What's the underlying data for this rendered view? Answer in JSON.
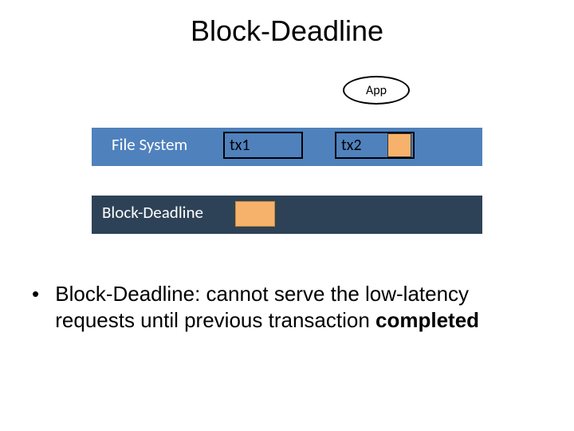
{
  "title": "Block-Deadline",
  "app_label": "App",
  "fs": {
    "label": "File System",
    "tx1": "tx1",
    "tx2": "tx2"
  },
  "bd": {
    "label": "Block-Deadline"
  },
  "bullet": {
    "dot": "•",
    "text_prefix": "Block-Deadline: cannot serve the low-latency requests until previous transaction ",
    "text_bold": "completed"
  }
}
